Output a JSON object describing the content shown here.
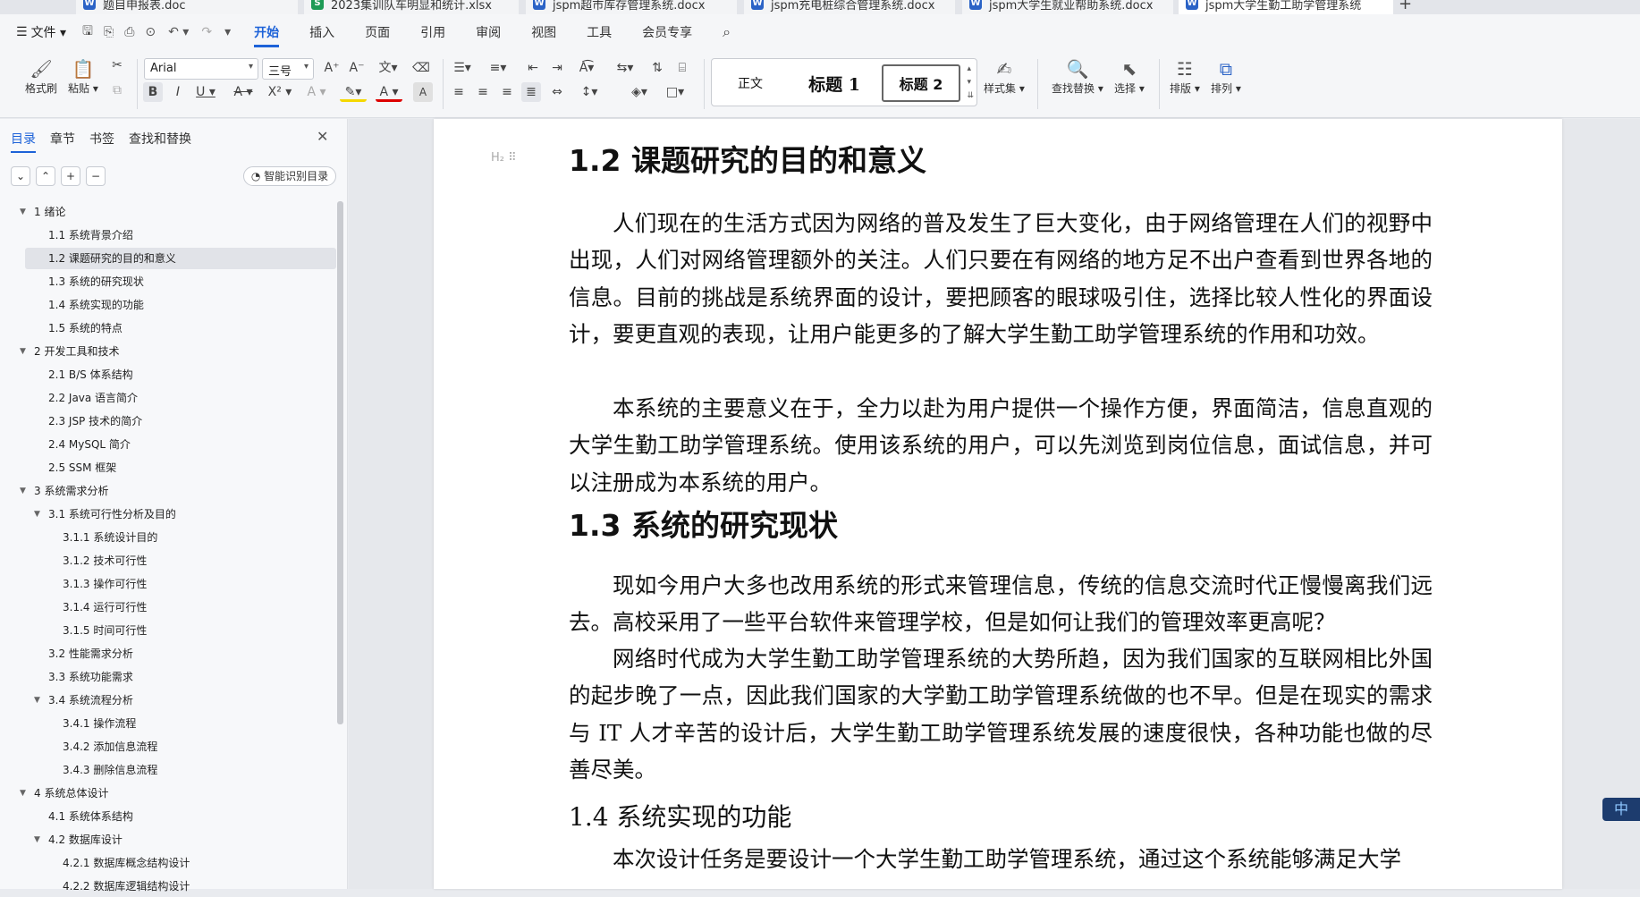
{
  "tabs": [
    {
      "label": "题目申报表.doc",
      "color": "#2b63c6",
      "letter": "W"
    },
    {
      "label": "2023集训队车明显和统计.xlsx",
      "color": "#1e9b56",
      "letter": "S"
    },
    {
      "label": "jspm超市库存管理系统.docx",
      "color": "#2b63c6",
      "letter": "W"
    },
    {
      "label": "jspm充电桩综合管理系统.docx",
      "color": "#2b63c6",
      "letter": "W"
    },
    {
      "label": "jspm大学生就业帮助系统.docx",
      "color": "#2b63c6",
      "letter": "W"
    },
    {
      "label": "jspm大学生勤工助学管理系统",
      "color": "#2b63c6",
      "letter": "W"
    }
  ],
  "menu": {
    "file": "文件",
    "items": [
      "开始",
      "插入",
      "页面",
      "引用",
      "审阅",
      "视图",
      "工具",
      "会员专享"
    ],
    "active": "开始"
  },
  "ribbon": {
    "format_painter": "格式刷",
    "paste": "粘贴",
    "font_name": "Arial",
    "font_size": "三号",
    "style_normal": "正文",
    "style_h1": "标题 1",
    "style_h2": "标题 2",
    "style_set": "样式集",
    "find_replace": "查找替换",
    "select": "选择",
    "layout": "排版",
    "arrange": "排列"
  },
  "left_panel": {
    "tabs": [
      "目录",
      "章节",
      "书签",
      "查找和替换"
    ],
    "smart_toc": "智能识别目录",
    "toc": [
      {
        "label": "1  绪论",
        "level": 0,
        "expand": true
      },
      {
        "label": "1.1 系统背景介绍",
        "level": 1
      },
      {
        "label": "1.2 课题研究的目的和意义",
        "level": 1,
        "selected": true
      },
      {
        "label": "1.3 系统的研究现状",
        "level": 1
      },
      {
        "label": "1.4 系统实现的功能",
        "level": 1
      },
      {
        "label": "1.5 系统的特点",
        "level": 1
      },
      {
        "label": "2  开发工具和技术",
        "level": 0,
        "expand": true
      },
      {
        "label": "2.1 B/S 体系结构",
        "level": 1
      },
      {
        "label": "2.2 Java 语言简介",
        "level": 1
      },
      {
        "label": "2.3 JSP 技术的简介",
        "level": 1
      },
      {
        "label": "2.4 MySQL 简介",
        "level": 1
      },
      {
        "label": "2.5 SSM 框架",
        "level": 1
      },
      {
        "label": "3  系统需求分析",
        "level": 0,
        "expand": true
      },
      {
        "label": "3.1  系统可行性分析及目的",
        "level": 1,
        "expand": true
      },
      {
        "label": "3.1.1  系统设计目的",
        "level": 2
      },
      {
        "label": "3.1.2  技术可行性",
        "level": 2
      },
      {
        "label": "3.1.3  操作可行性",
        "level": 2
      },
      {
        "label": "3.1.4  运行可行性",
        "level": 2
      },
      {
        "label": "3.1.5  时间可行性",
        "level": 2
      },
      {
        "label": "3.2  性能需求分析",
        "level": 1
      },
      {
        "label": "3.3 系统功能需求",
        "level": 1
      },
      {
        "label": "3.4 系统流程分析",
        "level": 1,
        "expand": true
      },
      {
        "label": "3.4.1 操作流程",
        "level": 2
      },
      {
        "label": "3.4.2 添加信息流程",
        "level": 2
      },
      {
        "label": "3.4.3 删除信息流程",
        "level": 2
      },
      {
        "label": "4    系统总体设计",
        "level": 0,
        "expand": true
      },
      {
        "label": "4.1  系统体系结构",
        "level": 1
      },
      {
        "label": "4.2  数据库设计",
        "level": 1,
        "expand": true
      },
      {
        "label": "4.2.1  数据库概念结构设计",
        "level": 2
      },
      {
        "label": "4.2.2  数据库逻辑结构设计",
        "level": 2
      }
    ]
  },
  "document": {
    "h12_num": "1.2",
    "h12_text": "课题研究的目的和意义",
    "p1": "人们现在的生活方式因为网络的普及发生了巨大变化，由于网络管理在人们的视野中出现，人们对网络管理额外的关注。人们只要在有网络的地方足不出户查看到世界各地的信息。目前的挑战是系统界面的设计，要把顾客的眼球吸引住，选择比较人性化的界面设计，要更直观的表现，让用户能更多的了解大学生勤工助学管理系统的作用和功效。",
    "p2": "本系统的主要意义在于，全力以赴为用户提供一个操作方便，界面简洁，信息直观的大学生勤工助学管理系统。使用该系统的用户，可以先浏览到岗位信息，面试信息，并可以注册成为本系统的用户。",
    "h13_num": "1.3",
    "h13_text": "系统的研究现状",
    "p3": "现如今用户大多也改用系统的形式来管理信息，传统的信息交流时代正慢慢离我们远去。高校采用了一些平台软件来管理学校，但是如何让我们的管理效率更高呢？",
    "p4": "网络时代成为大学生勤工助学管理系统的大势所趋，因为我们国家的互联网相比外国的起步晚了一点，因此我们国家的大学勤工助学管理系统做的也不早。但是在现实的需求与 IT 人才辛苦的设计后，大学生勤工助学管理系统发展的速度很快，各种功能也做的尽善尽美。",
    "h14": "1.4 系统实现的功能",
    "p5": "本次设计任务是要设计一个大学生勤工助学管理系统，通过这个系统能够满足大学"
  }
}
